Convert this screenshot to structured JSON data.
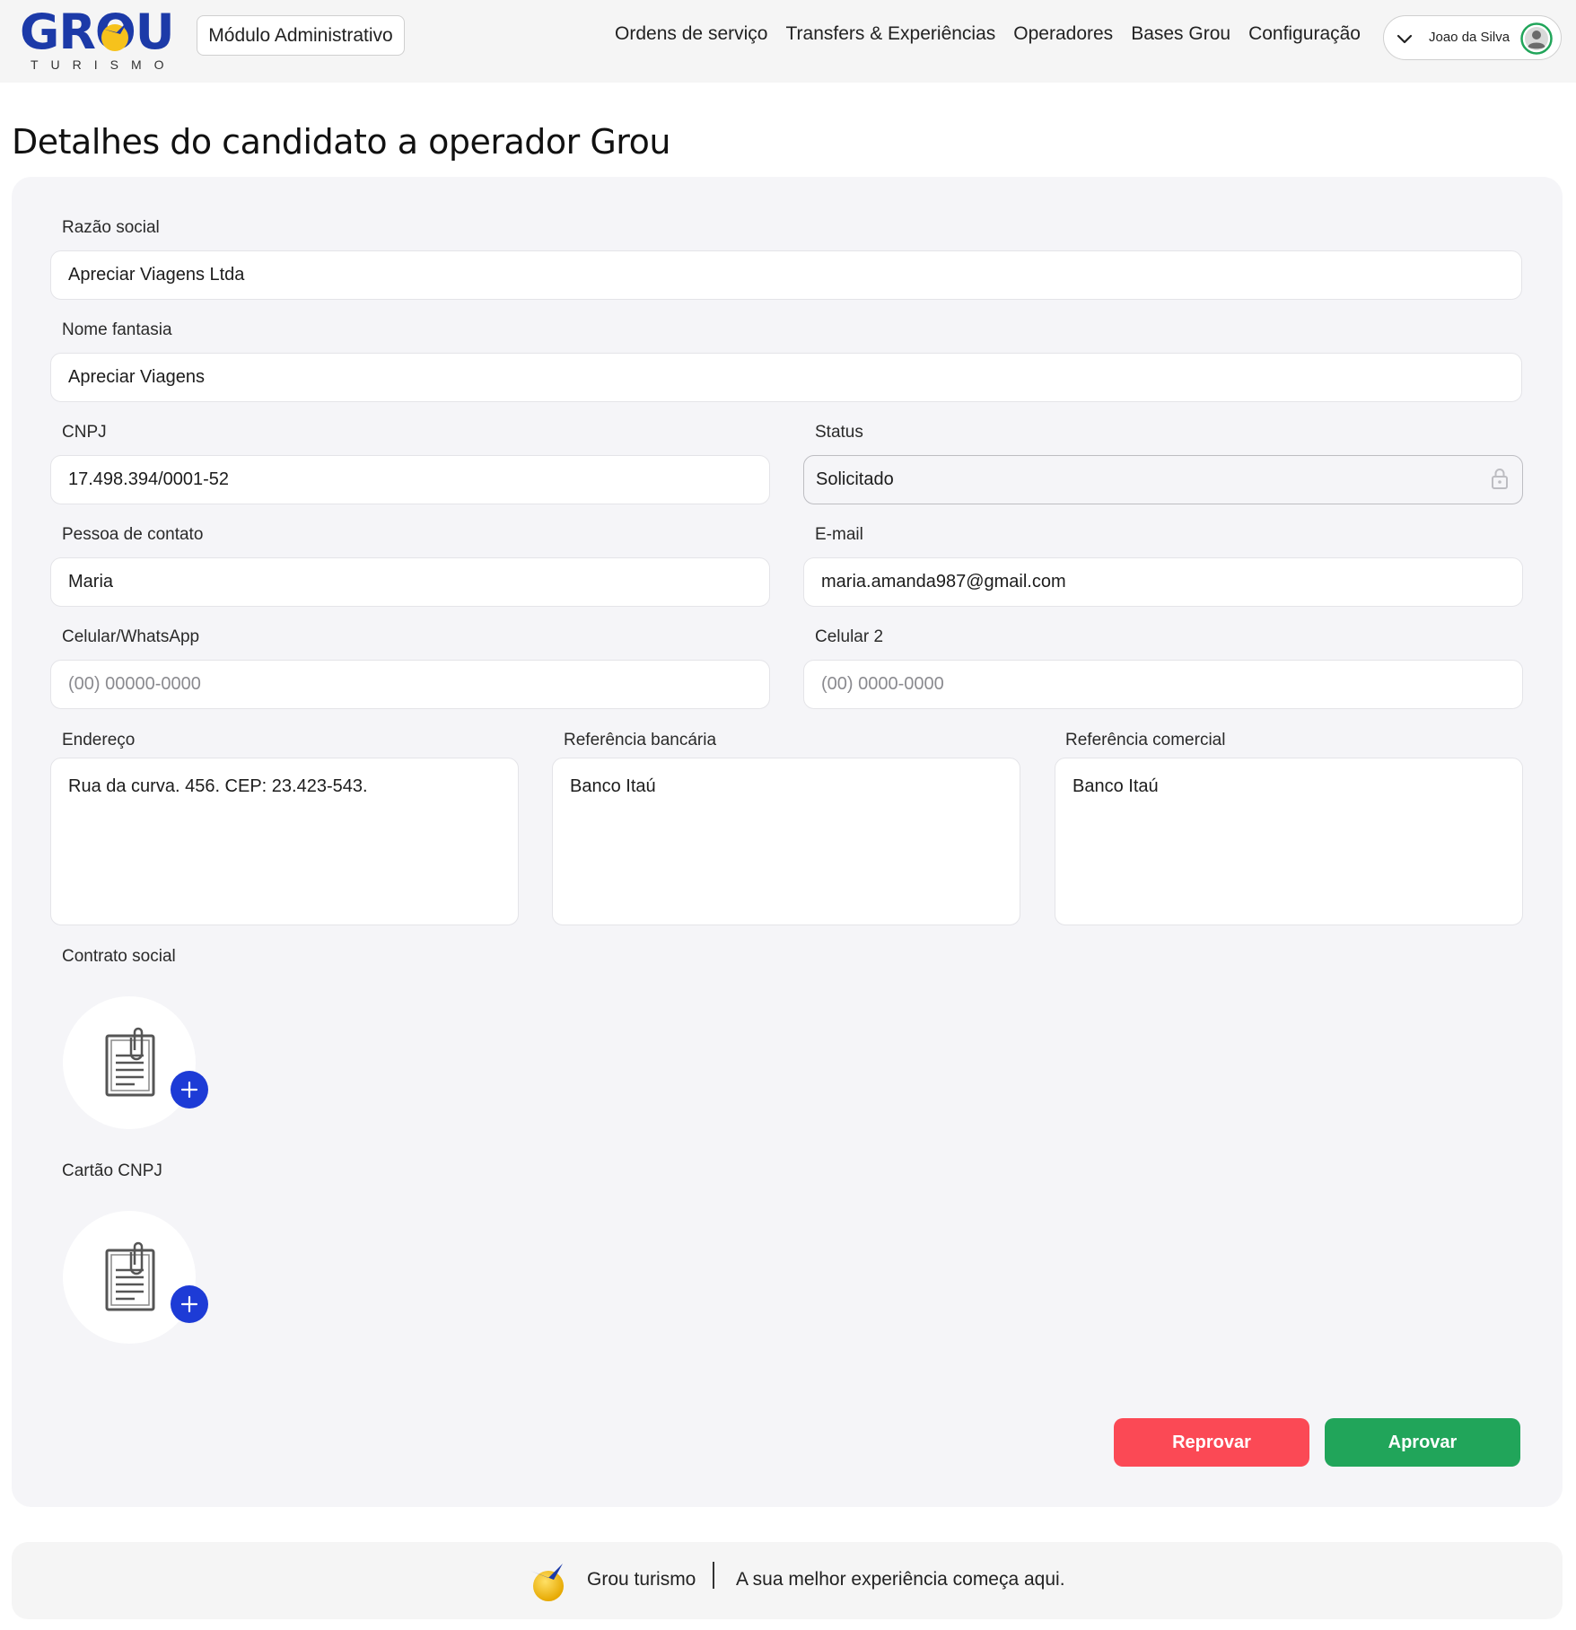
{
  "header": {
    "logo_text": "GROU",
    "logo_subtext": "TURISMO",
    "module_label": "Módulo Administrativo",
    "nav": [
      {
        "label": "Ordens de serviço"
      },
      {
        "label": "Transfers & Experiências"
      },
      {
        "label": "Operadores"
      },
      {
        "label": "Bases Grou"
      },
      {
        "label": "Configuração"
      }
    ],
    "user_name": "Joao da Silva"
  },
  "page_title": "Detalhes do candidato a operador Grou",
  "form": {
    "razao_social": {
      "label": "Razão social",
      "value": "Apreciar Viagens Ltda"
    },
    "nome_fantasia": {
      "label": "Nome fantasia",
      "value": "Apreciar Viagens"
    },
    "cnpj": {
      "label": "CNPJ",
      "value": "17.498.394/0001-52"
    },
    "status": {
      "label": "Status",
      "value": "Solicitado"
    },
    "pessoa_contato": {
      "label": "Pessoa de contato",
      "value": "Maria"
    },
    "email": {
      "label": "E-mail",
      "value": "maria.amanda987@gmail.com"
    },
    "celular": {
      "label": "Celular/WhatsApp",
      "placeholder": "(00) 00000-0000"
    },
    "celular2": {
      "label": "Celular 2",
      "placeholder": "(00) 0000-0000"
    },
    "endereco": {
      "label": "Endereço",
      "value": "Rua da curva. 456. CEP: 23.423-543."
    },
    "ref_bancaria": {
      "label": "Referência bancária",
      "value": "Banco Itaú"
    },
    "ref_comercial": {
      "label": "Referência comercial",
      "value": "Banco Itaú"
    },
    "contrato_social": {
      "label": "Contrato social"
    },
    "cartao_cnpj": {
      "label": "Cartão CNPJ"
    }
  },
  "actions": {
    "reject_label": "Reprovar",
    "approve_label": "Aprovar"
  },
  "footer": {
    "brand": "Grou turismo",
    "tagline": "A sua melhor experiência começa aqui."
  },
  "colors": {
    "brand_blue": "#1c3aa8",
    "plus_blue": "#1d3bd6",
    "reject_red": "#fb4955",
    "approve_green": "#21a55a",
    "card_bg": "#f5f5f8"
  },
  "icons": [
    "sun-bird-logo-icon",
    "chevron-down-icon",
    "avatar-icon",
    "lock-icon",
    "document-clip-icon",
    "plus-icon"
  ]
}
